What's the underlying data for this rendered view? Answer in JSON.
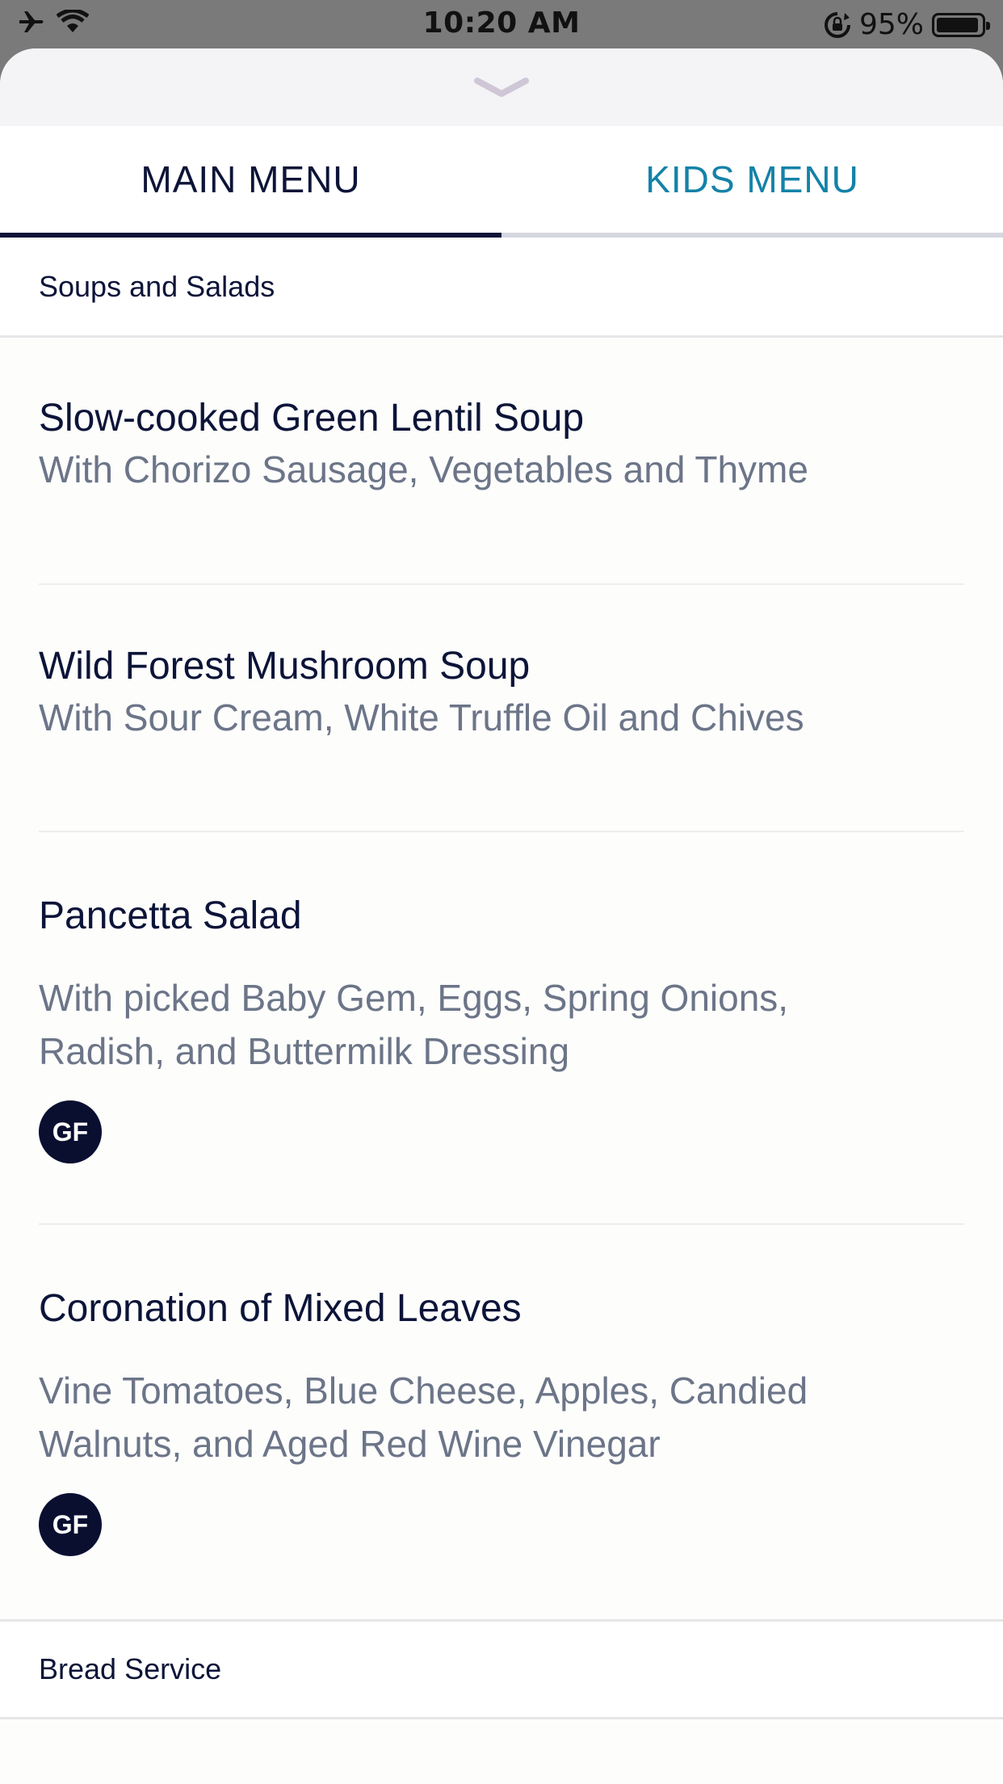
{
  "status_bar": {
    "time": "10:20 AM",
    "battery_text": "95%",
    "battery_level": 0.95,
    "icons": [
      "airplane-icon",
      "wifi-icon",
      "rotation-lock-icon",
      "battery-icon"
    ]
  },
  "sheet": {
    "grabber_icon": "chevron-down-icon"
  },
  "tabs": [
    {
      "label": "MAIN MENU",
      "selected": true
    },
    {
      "label": "KIDS MENU",
      "selected": false
    }
  ],
  "colors": {
    "navy": "#0c1438",
    "kids_tab": "#1482a8",
    "description": "#6c7588",
    "badge": "#0a0f30"
  },
  "sections": [
    {
      "title": "Soups and Salads",
      "items": [
        {
          "name": "Slow-cooked Green Lentil Soup",
          "description": "With Chorizo Sausage, Vegetables and Thyme"
        },
        {
          "name": "Wild Forest Mushroom Soup",
          "description": "With Sour Cream, White Truffle Oil and Chives"
        },
        {
          "name": "Pancetta Salad",
          "description_lines": [
            "With picked Baby Gem, Eggs, Spring Onions,",
            "Radish, and Buttermilk Dressing"
          ],
          "badge": "GF"
        },
        {
          "name": "Coronation of Mixed Leaves",
          "description_lines": [
            "Vine Tomatoes, Blue Cheese, Apples, Candied",
            "Walnuts, and Aged Red Wine Vinegar"
          ],
          "badge": "GF"
        }
      ]
    },
    {
      "title": "Bread Service",
      "items": []
    }
  ]
}
